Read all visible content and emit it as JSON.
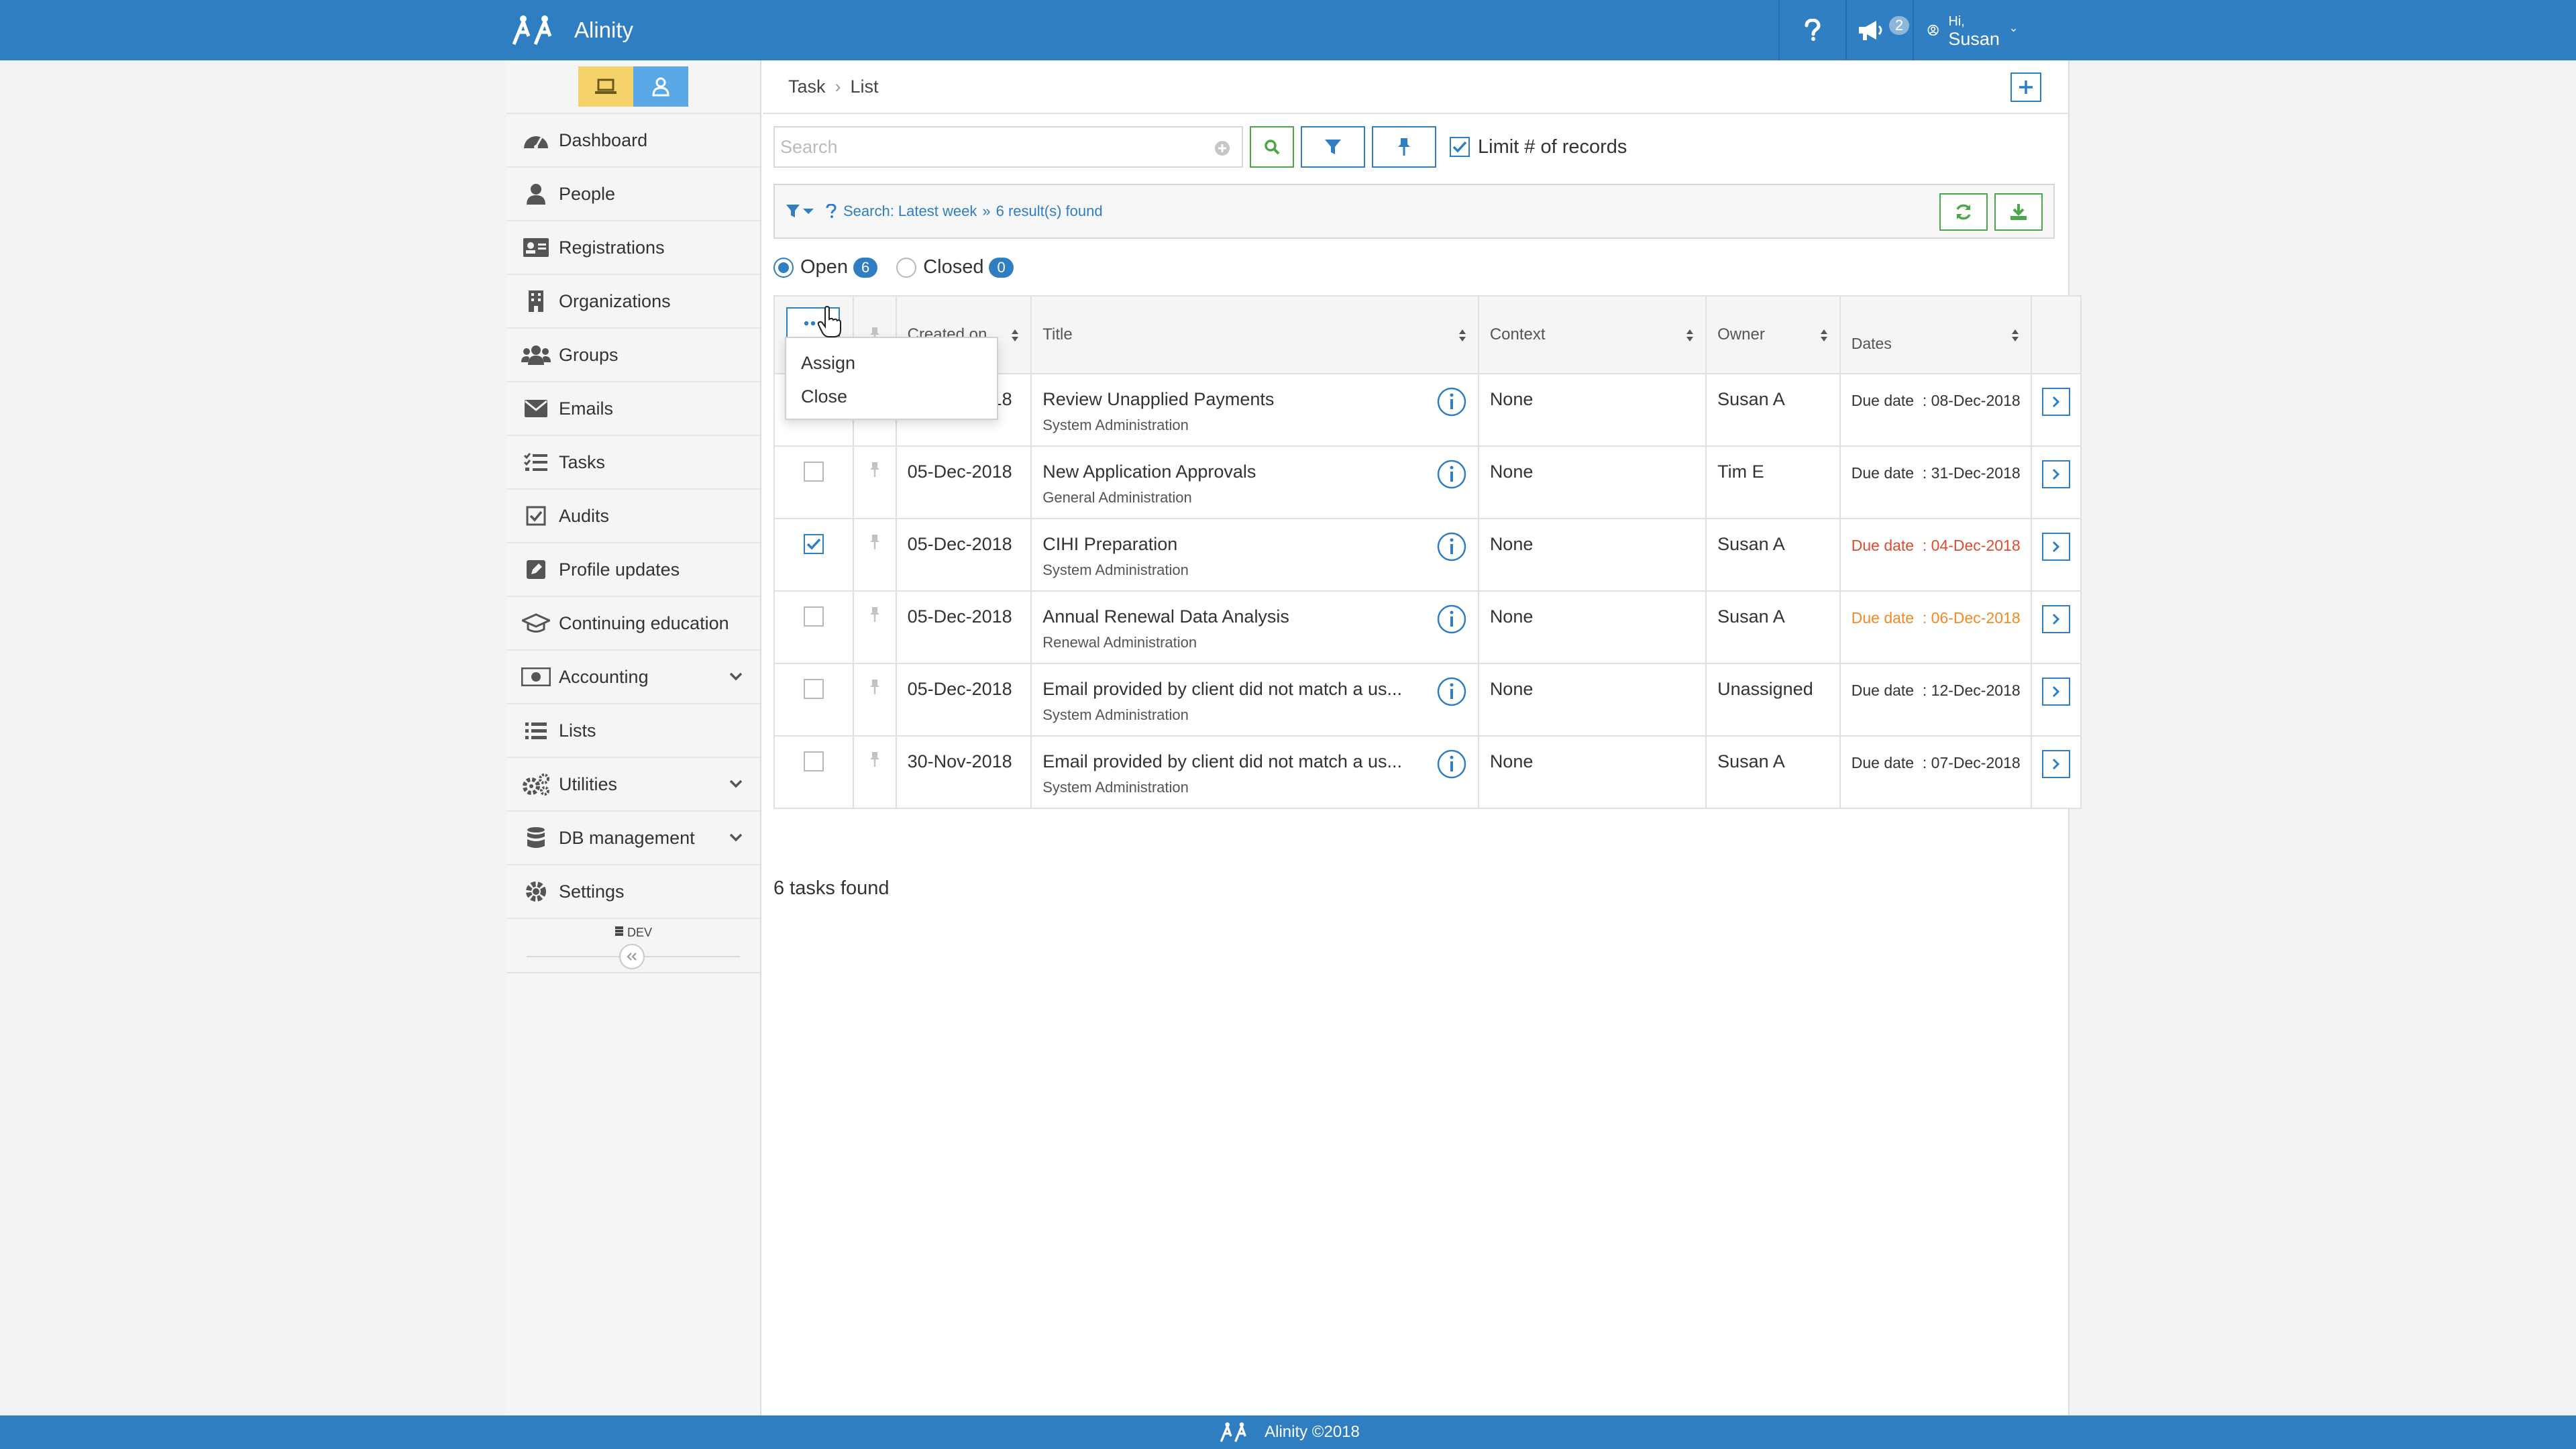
{
  "app": {
    "name": "Alinity"
  },
  "topbar": {
    "notifications_count": "2",
    "user_greeting": "Hi,",
    "user_name": "Susan"
  },
  "sidebar": {
    "items": [
      {
        "label": "Dashboard",
        "icon": "dashboard-icon"
      },
      {
        "label": "People",
        "icon": "person-icon"
      },
      {
        "label": "Registrations",
        "icon": "id-card-icon"
      },
      {
        "label": "Organizations",
        "icon": "building-icon"
      },
      {
        "label": "Groups",
        "icon": "users-icon"
      },
      {
        "label": "Emails",
        "icon": "envelope-icon"
      },
      {
        "label": "Tasks",
        "icon": "tasks-icon"
      },
      {
        "label": "Audits",
        "icon": "checkbox-icon"
      },
      {
        "label": "Profile updates",
        "icon": "edit-icon"
      },
      {
        "label": "Continuing education",
        "icon": "graduation-cap-icon"
      },
      {
        "label": "Accounting",
        "icon": "money-icon"
      },
      {
        "label": "Lists",
        "icon": "list-icon"
      },
      {
        "label": "Utilities",
        "icon": "cogs-icon"
      },
      {
        "label": "DB management",
        "icon": "database-icon"
      },
      {
        "label": "Settings",
        "icon": "gear-icon"
      }
    ],
    "dev_label": "DEV"
  },
  "breadcrumb": {
    "root": "Task",
    "current": "List"
  },
  "search": {
    "placeholder": "Search",
    "value": "",
    "limit_label": "Limit # of records"
  },
  "filter_summary": {
    "search_text": "Search: Latest week",
    "result_text": "6 result(s) found"
  },
  "status": {
    "open_label": "Open",
    "open_count": "6",
    "closed_label": "Closed",
    "closed_count": "0"
  },
  "table": {
    "columns": {
      "created": "Created on",
      "title": "Title",
      "context": "Context",
      "owner": "Owner",
      "dates": "Dates"
    },
    "rows": [
      {
        "created": "05-Dec-2018",
        "title": "Review Unapplied Payments",
        "group": "System Administration",
        "context": "None",
        "owner": "Susan A",
        "due_label": "Due date",
        "due": ": 08-Dec-2018",
        "checked": false
      },
      {
        "created": "05-Dec-2018",
        "title": "New Application Approvals",
        "group": "General Administration",
        "context": "None",
        "owner": "Tim E",
        "due_label": "Due date",
        "due": ": 31-Dec-2018",
        "checked": false
      },
      {
        "created": "05-Dec-2018",
        "title": "CIHI Preparation",
        "group": "System Administration",
        "context": "None",
        "owner": "Susan A",
        "due_label": "Due date",
        "due": ": 04-Dec-2018",
        "checked": true
      },
      {
        "created": "05-Dec-2018",
        "title": "Annual Renewal Data Analysis",
        "group": "Renewal Administration",
        "context": "None",
        "owner": "Susan A",
        "due_label": "Due date",
        "due": ": 06-Dec-2018",
        "checked": false
      },
      {
        "created": "05-Dec-2018",
        "title": "Email provided by client did not match a us...",
        "group": "System Administration",
        "context": "None",
        "owner": "Unassigned",
        "due_label": "Due date",
        "due": ": 12-Dec-2018",
        "checked": false
      },
      {
        "created": "30-Nov-2018",
        "title": "Email provided by client did not match a us...",
        "group": "System Administration",
        "context": "None",
        "owner": "Susan A",
        "due_label": "Due date",
        "due": ": 07-Dec-2018",
        "checked": false
      }
    ]
  },
  "tasks_found": "6 tasks found",
  "bulk_menu": {
    "items": [
      "Assign",
      "Close"
    ]
  },
  "footer": {
    "text": "Alinity ©2018"
  },
  "colors": {
    "primary": "#2e7ec1",
    "green": "#4aa84a",
    "overdue": "#e04a2f",
    "due_soon": "#f08a24"
  }
}
